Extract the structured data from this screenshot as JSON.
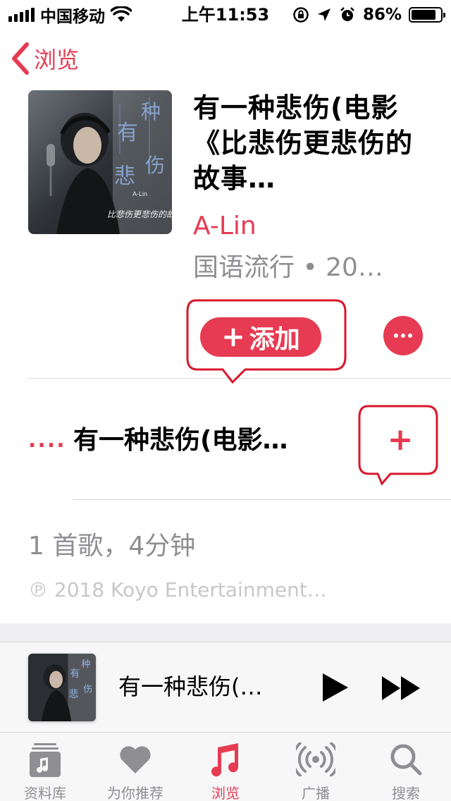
{
  "status_bar": {
    "carrier": "中国移动",
    "time": "上午11:53",
    "battery_percent": "86%",
    "battery_level": 0.86
  },
  "nav": {
    "back_label": "浏览"
  },
  "album": {
    "title": "有一种悲伤(电影《比悲伤更悲伤的故事…",
    "artist": "A-Lin",
    "meta": "国语流行 • 20…",
    "add_label": "添加"
  },
  "tracks": [
    {
      "number": "....",
      "title": "有一种悲伤(电影…"
    }
  ],
  "summary": {
    "song_count": "1 首歌，4分钟",
    "copyright": "℗ 2018 Koyo Entertainment…"
  },
  "now_playing": {
    "title": "有一种悲伤(…"
  },
  "tab_bar": {
    "tabs": [
      {
        "label": "资料库",
        "icon": "library-icon",
        "active": false
      },
      {
        "label": "为你推荐",
        "icon": "heart-icon",
        "active": false
      },
      {
        "label": "浏览",
        "icon": "music-note-icon",
        "active": true
      },
      {
        "label": "广播",
        "icon": "radio-icon",
        "active": false
      },
      {
        "label": "搜索",
        "icon": "search-icon",
        "active": false
      }
    ]
  },
  "colors": {
    "accent": "#e63b52",
    "secondary_text": "#8e8e93",
    "annotation": "#d9172b"
  }
}
